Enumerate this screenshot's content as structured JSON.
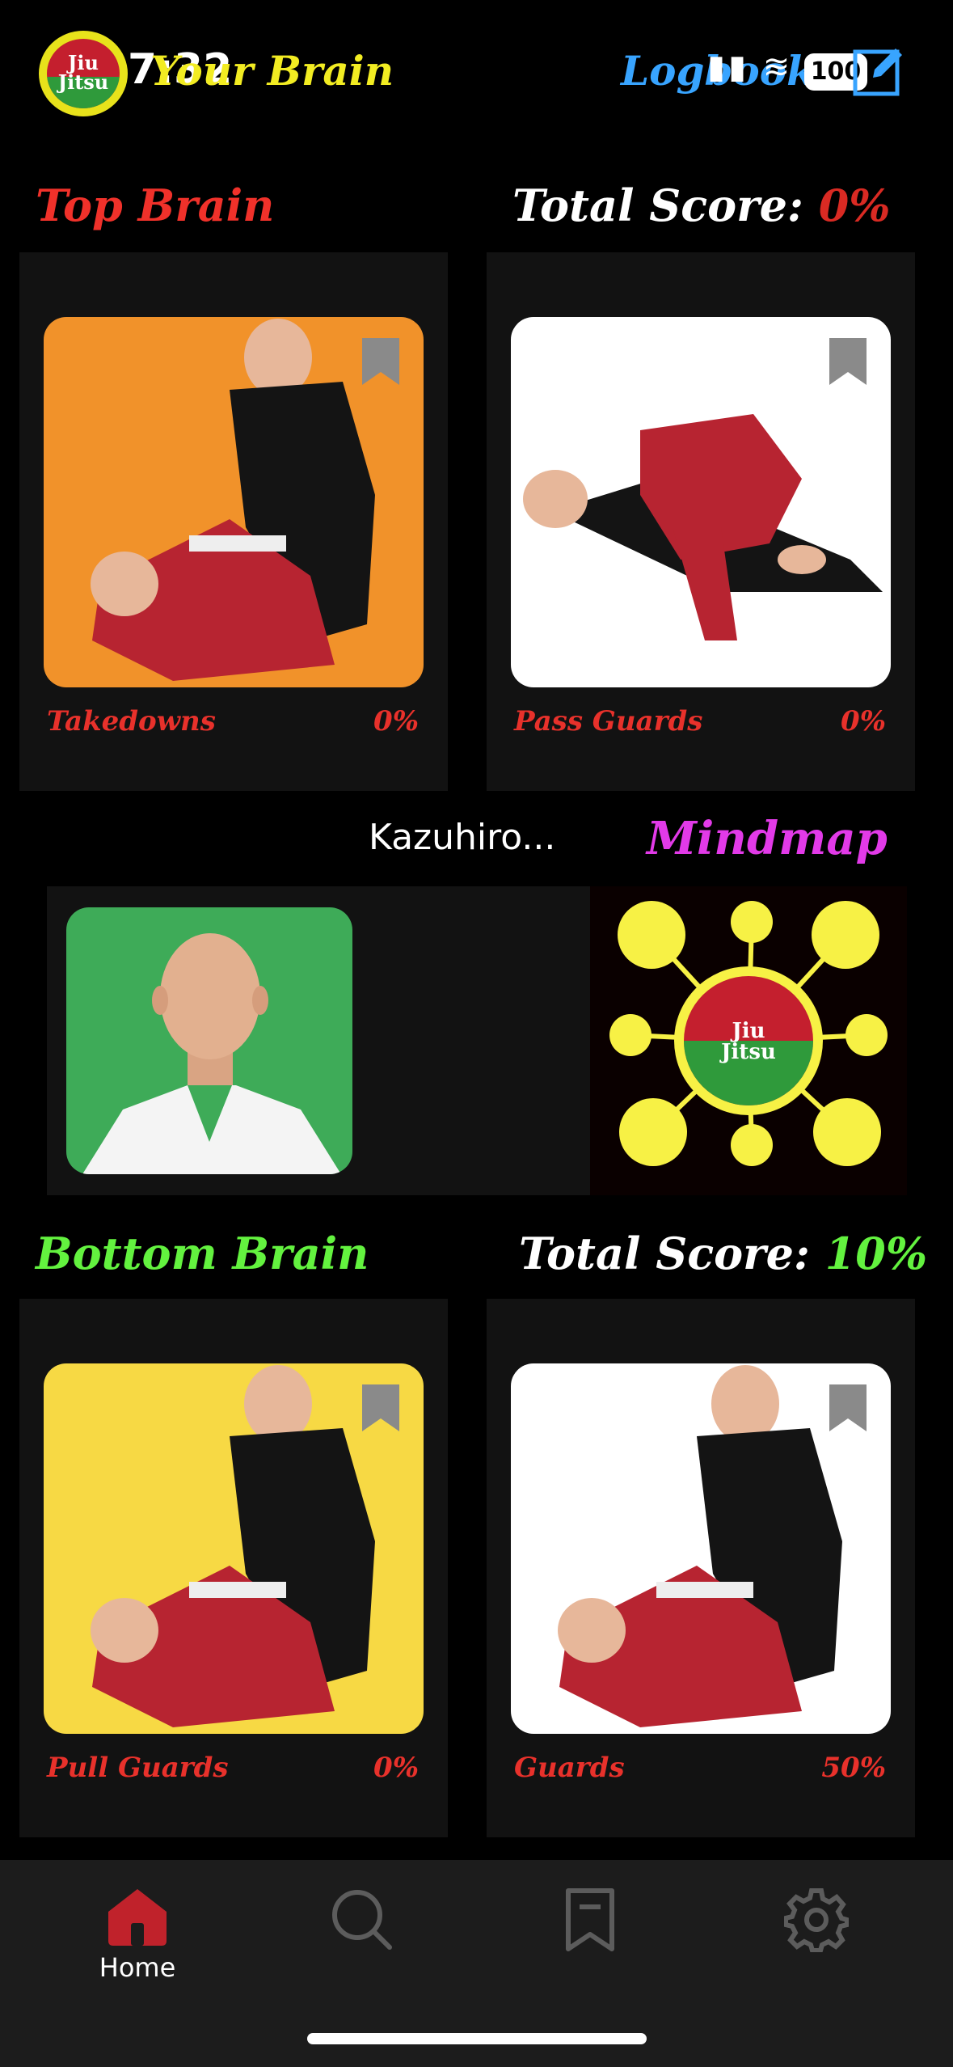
{
  "status_bar": {
    "time": "7:32",
    "battery": "100"
  },
  "header": {
    "title": "Your Brain",
    "logbook": "Logbook"
  },
  "logo": {
    "text": "Jiu Jitsu"
  },
  "top": {
    "title": "Top Brain",
    "score_label": "Total Score:",
    "score_value": "0%",
    "cards": [
      {
        "label": "Takedowns",
        "pct": "0%",
        "bg": "#f1922a"
      },
      {
        "label": "Pass Guards",
        "pct": "0%",
        "bg": "#ffffff"
      }
    ]
  },
  "profile": {
    "name": "Kazuhiro..."
  },
  "mindmap": {
    "label": "Mindmap",
    "center_text": "Jiu Jitsu"
  },
  "bottom": {
    "title": "Bottom Brain",
    "score_label": "Total Score:",
    "score_value": "10%",
    "cards": [
      {
        "label": "Pull Guards",
        "pct": "0%",
        "bg": "#f7d944"
      },
      {
        "label": "Guards",
        "pct": "50%",
        "bg": "#ffffff"
      }
    ]
  },
  "nav": {
    "home_label": "Home"
  },
  "colors": {
    "accent_red": "#c0222b",
    "top_red": "#f0312a",
    "bottom_green": "#63f23f",
    "mindmap_yellow": "#f7f145"
  }
}
